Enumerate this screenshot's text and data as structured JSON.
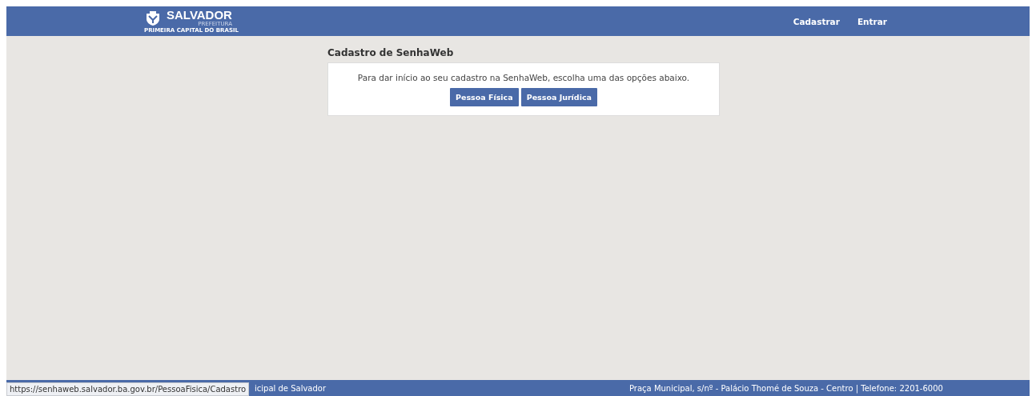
{
  "header": {
    "logo": {
      "name": "SALVADOR",
      "subtitle": "PREFEITURA",
      "tagline": "PRIMEIRA CAPITAL DO BRASIL"
    },
    "nav": [
      "Cadastrar",
      "Entrar"
    ]
  },
  "page": {
    "title": "Cadastro de SenhaWeb",
    "message": "Para dar início ao seu cadastro na SenhaWeb, escolha uma das opções abaixo.",
    "buttons": [
      "Pessoa Física",
      "Pessoa Jurídica"
    ]
  },
  "footer": {
    "left": "icipal de Salvador",
    "right": "Praça Municipal, s/nº - Palácio Thomé de Souza - Centro | Telefone: 2201-6000"
  },
  "status_url": "https://senhaweb.salvador.ba.gov.br/PessoaFisica/Cadastro"
}
